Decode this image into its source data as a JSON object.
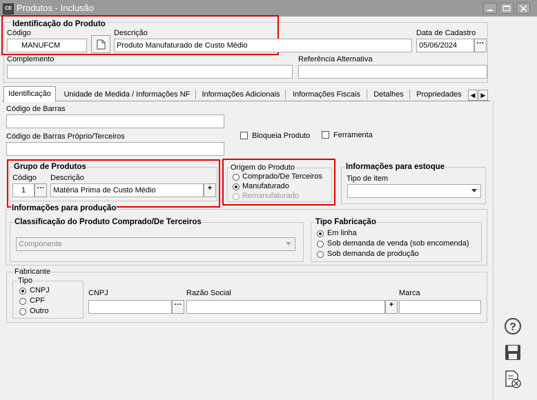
{
  "window": {
    "title": "Produtos - Inclusão",
    "app_icon_text": "CE"
  },
  "identificacao": {
    "group_label": "Identificação do Produto",
    "codigo_label": "Código",
    "codigo_value": "MANUFCM",
    "descricao_label": "Descrição",
    "descricao_value": "Produto Manufaturado de Custo Médio",
    "data_cadastro_label": "Data de Cadastro",
    "data_cadastro_value": "05/06/2024",
    "complemento_label": "Complemento",
    "complemento_value": "",
    "referencia_label": "Referência Alternativa",
    "referencia_value": ""
  },
  "tabs": [
    {
      "label": "Identificação"
    },
    {
      "label": "Unidade de Medida / Informações NF"
    },
    {
      "label": "Informações Adicionais"
    },
    {
      "label": "Informações Fiscais"
    },
    {
      "label": "Detalhes"
    },
    {
      "label": "Propriedades"
    }
  ],
  "barras": {
    "codigo_barras_label": "Código de Barras",
    "codigo_barras_value": "",
    "codigo_barras_proprio_label": "Código de Barras Próprio/Terceiros",
    "codigo_barras_proprio_value": "",
    "bloqueia_label": "Bloqueia Produto",
    "ferramenta_label": "Ferramenta"
  },
  "grupo": {
    "group_label": "Grupo de Produtos",
    "codigo_label": "Código",
    "codigo_value": "1",
    "descricao_label": "Descrição",
    "descricao_value": "Matéria Prima de Custo Médio"
  },
  "origem": {
    "group_label": "Origem do Produto",
    "options": [
      "Comprado/De Terceiros",
      "Manufaturado",
      "Remanufaturado"
    ],
    "selected": "Manufaturado"
  },
  "estoque": {
    "group_label": "Informações para estoque",
    "tipo_item_label": "Tipo de item",
    "tipo_item_value": ""
  },
  "producao": {
    "group_label": "Informações para produção",
    "classificacao_label": "Classificação do Produto Comprado/De Terceiros",
    "classificacao_value": "Componente",
    "tipo_fabricacao_label": "Tipo Fabricação",
    "tipo_fabricacao_options": [
      "Em linha",
      "Sob demanda de venda (sob encomenda)",
      "Sob demanda de produção"
    ],
    "tipo_fabricacao_selected": "Em linha"
  },
  "fabricante": {
    "group_label": "Fabricante",
    "tipo_label": "Tipo",
    "tipo_options": [
      "CNPJ",
      "CPF",
      "Outro"
    ],
    "tipo_selected": "CNPJ",
    "cnpj_label": "CNPJ",
    "cnpj_value": "",
    "razao_label": "Razão Social",
    "razao_value": "",
    "marca_label": "Marca",
    "marca_value": ""
  },
  "side_icons": [
    "help-icon",
    "save-icon",
    "cancel-document-icon"
  ]
}
